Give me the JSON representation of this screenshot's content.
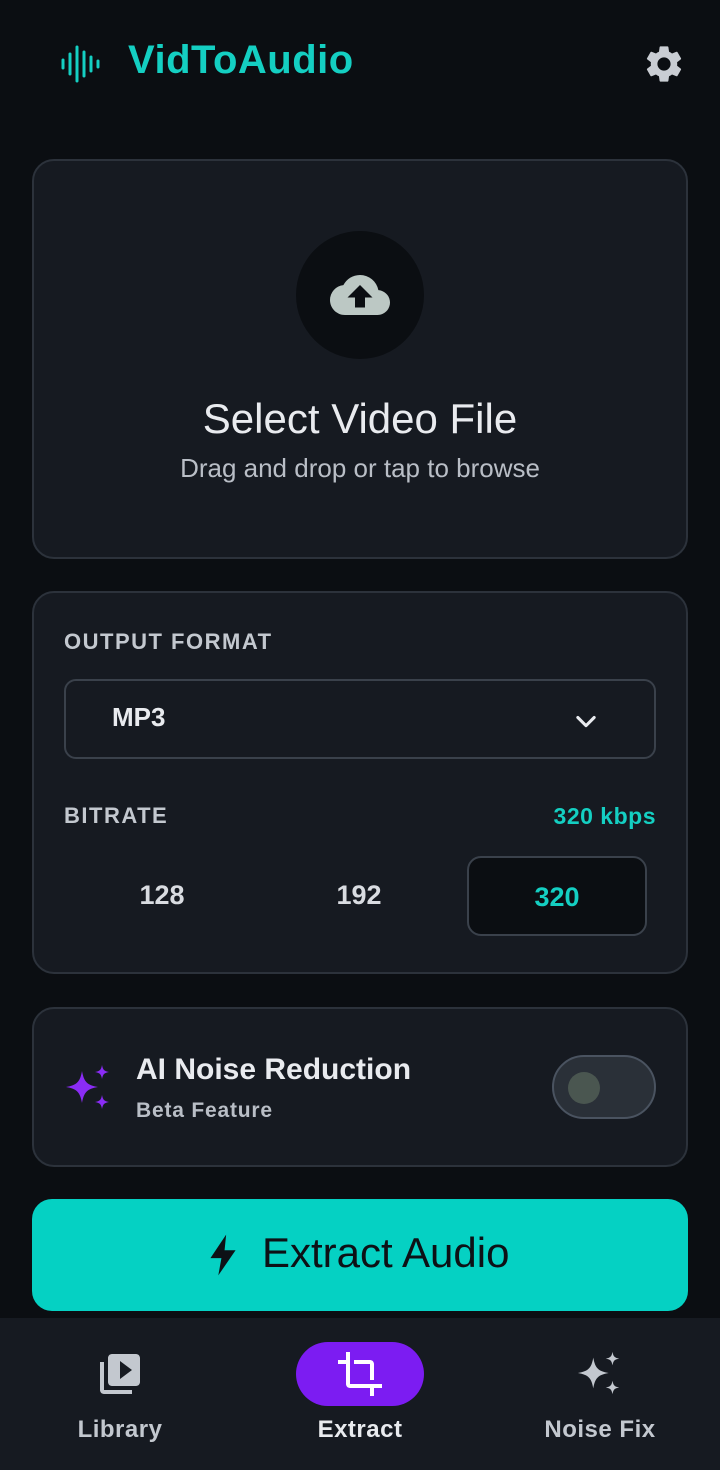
{
  "header": {
    "title": "VidToAudio",
    "logo_icon": "audio-waveform-icon",
    "settings_icon": "gear-icon"
  },
  "upload": {
    "icon": "cloud-upload-icon",
    "title": "Select Video File",
    "subtitle": "Drag and drop or tap to browse"
  },
  "format": {
    "label": "OUTPUT FORMAT",
    "selected": "MP3",
    "chevron_icon": "chevron-down-icon",
    "bitrate_label": "BITRATE",
    "bitrate_value": "320 kbps",
    "bitrate_options": [
      "128",
      "192",
      "320"
    ],
    "bitrate_selected": "320"
  },
  "noise": {
    "icon": "sparkles-icon",
    "title": "AI Noise Reduction",
    "subtitle": "Beta Feature",
    "enabled": false
  },
  "extract_button": {
    "icon": "bolt-icon",
    "label": "Extract Audio"
  },
  "nav": {
    "items": [
      {
        "label": "Library",
        "icon": "video-library-icon",
        "active": false
      },
      {
        "label": "Extract",
        "icon": "crop-icon",
        "active": true
      },
      {
        "label": "Noise Fix",
        "icon": "sparkles-icon",
        "active": false
      }
    ]
  },
  "colors": {
    "background": "#0b0e12",
    "card": "#161a21",
    "accent": "#14cfc2",
    "button": "#05d1c3",
    "purple": "#7c1cf2"
  }
}
